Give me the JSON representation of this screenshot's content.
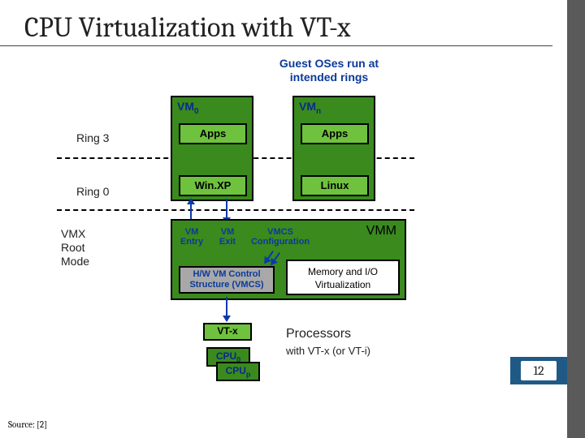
{
  "title": "CPU Virtualization with VT-x",
  "caption_top": "Guest OSes run at intended rings",
  "rings": {
    "r3": "Ring 3",
    "r0": "Ring 0",
    "root": "VMX Root Mode"
  },
  "vm": {
    "vm0": "VM",
    "vm0_sub": "0",
    "vmn": "VM",
    "vmn_sub": "n",
    "apps": "Apps",
    "os0": "Win.XP",
    "os1": "Linux"
  },
  "vmm": {
    "label": "VMM",
    "entry": "VM Entry",
    "exit": "VM Exit",
    "vmcs_conf": "VMCS Configuration",
    "vmcs_box": "H/W VM Control Structure (VMCS)",
    "memio": "Memory and I/O Virtualization"
  },
  "proc": {
    "vtx": "VT-x",
    "cpu0": "CPU",
    "cpu0_sub": "0",
    "cpup": "CPU",
    "cpup_sub": "p",
    "label": "Processors",
    "sub": "with VT-x (or VT-i)"
  },
  "page_number": "12",
  "source": "Source: [2]"
}
